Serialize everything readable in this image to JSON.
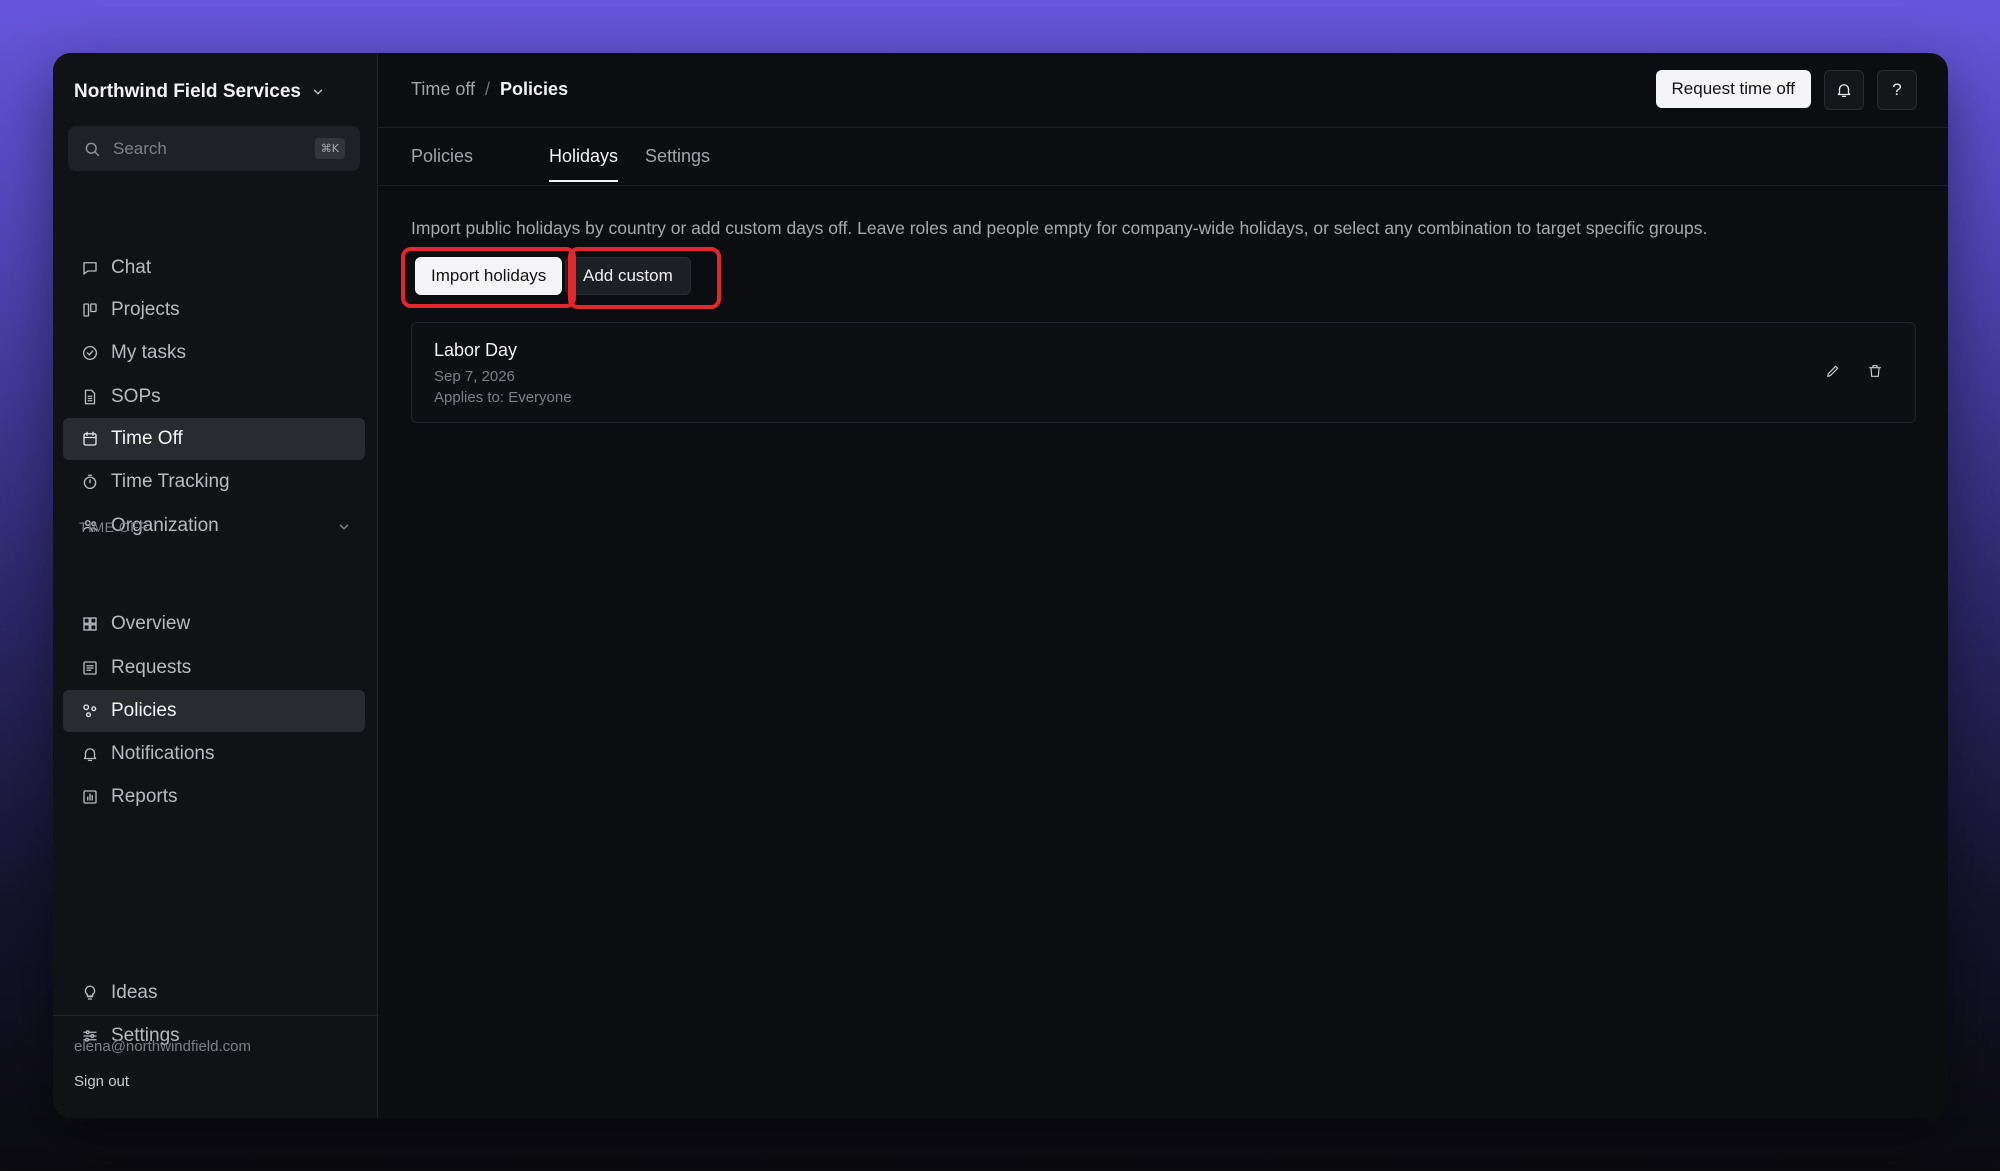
{
  "org": {
    "name": "Northwind Field Services"
  },
  "search": {
    "placeholder": "Search",
    "shortcut": "⌘K"
  },
  "nav": {
    "primary": [
      {
        "label": "Chat",
        "icon": "chat-icon"
      },
      {
        "label": "Projects",
        "icon": "projects-icon"
      },
      {
        "label": "My tasks",
        "icon": "check-circle-icon"
      },
      {
        "label": "SOPs",
        "icon": "document-icon"
      },
      {
        "label": "Time Off",
        "icon": "calendar-icon",
        "active": true
      },
      {
        "label": "Time Tracking",
        "icon": "stopwatch-icon"
      },
      {
        "label": "Organization",
        "icon": "people-icon"
      }
    ],
    "section_label": "TIME OFF",
    "secondary": [
      {
        "label": "Overview",
        "icon": "grid-icon"
      },
      {
        "label": "Requests",
        "icon": "list-icon"
      },
      {
        "label": "Policies",
        "icon": "policies-icon",
        "active": true
      },
      {
        "label": "Notifications",
        "icon": "bell-icon"
      },
      {
        "label": "Reports",
        "icon": "bar-chart-icon"
      }
    ],
    "bottom": [
      {
        "label": "Ideas",
        "icon": "lightbulb-icon"
      },
      {
        "label": "Settings",
        "icon": "sliders-icon"
      }
    ]
  },
  "account": {
    "email": "elena@northwindfield.com",
    "sign_out": "Sign out"
  },
  "breadcrumb": {
    "parent": "Time off",
    "separator": "/",
    "current": "Policies"
  },
  "header": {
    "request_button": "Request time off",
    "help_label": "?"
  },
  "tabs": [
    {
      "label": "Policies"
    },
    {
      "label": "Holidays",
      "active": true
    },
    {
      "label": "Settings"
    }
  ],
  "holidays": {
    "description": "Import public holidays by country or add custom days off. Leave roles and people empty for company-wide holidays, or select any combination to target specific groups.",
    "import_button": "Import holidays",
    "custom_button": "Add custom",
    "items": [
      {
        "name": "Labor Day",
        "date": "Sep 7, 2026",
        "applies": "Applies to: Everyone"
      }
    ]
  },
  "colors": {
    "highlight": "#e0282f",
    "accent_bg": "#6756dc"
  }
}
